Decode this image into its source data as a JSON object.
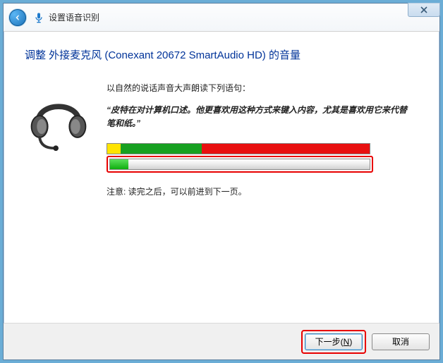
{
  "window": {
    "title": "设置语音识别",
    "close_label": "关闭"
  },
  "main": {
    "heading": "调整 外接麦克风 (Conexant 20672 SmartAudio HD) 的音量",
    "instruction": "以自然的说话声音大声朗读下列语句：",
    "sample_text": "“皮特在对计算机口述。他更喜欢用这种方式来键入内容，尤其是喜欢用它来代替笔和纸。”",
    "note": "注意: 读完之后，可以前进到下一页。",
    "level_bar": {
      "yellow_pct": 5,
      "green_pct": 31,
      "red_pct": 64
    },
    "progress_pct": 7
  },
  "footer": {
    "next_label_prefix": "下一步(",
    "next_hotkey": "N",
    "next_label_suffix": ")",
    "cancel_label": "取消"
  }
}
